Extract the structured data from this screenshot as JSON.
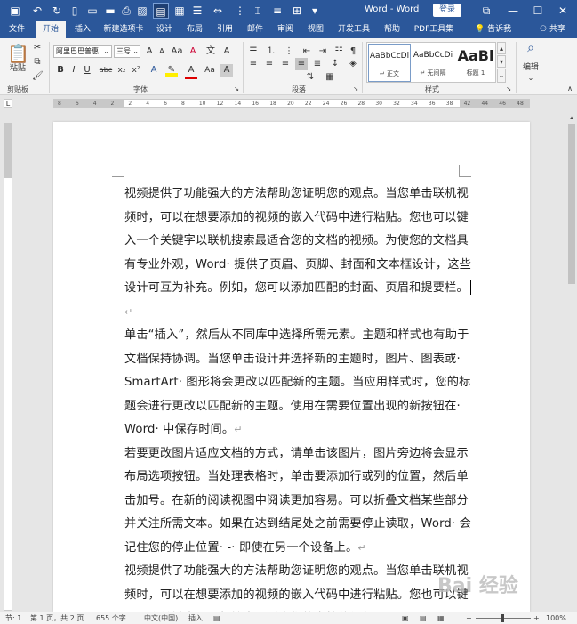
{
  "title_bar": {
    "quick_access": [
      "save-icon",
      "undo-icon",
      "redo-icon",
      "new-doc-icon",
      "print-preview-icon",
      "open-icon",
      "print-icon",
      "picture-icon",
      "read-mode-icon",
      "table-icon",
      "outline-icon",
      "spacing-icon",
      "more-icon",
      "page-icon",
      "customize-icon"
    ],
    "title": "Word - Word",
    "login": "登录",
    "window_controls": [
      "ribbon-display-icon",
      "minimize-icon",
      "restore-icon",
      "close-icon"
    ]
  },
  "tabs": [
    "文件",
    "开始",
    "插入",
    "新建选项卡",
    "设计",
    "布局",
    "引用",
    "邮件",
    "审阅",
    "视图",
    "开发工具",
    "帮助",
    "PDF工具集"
  ],
  "active_tab": "开始",
  "tell_me": "告诉我",
  "share": "共享",
  "ribbon": {
    "clipboard": {
      "paste": "粘贴",
      "label": "剪贴板"
    },
    "font": {
      "name": "阿里巴巴普惠",
      "size": "三号",
      "label": "字体",
      "buttons": [
        "B",
        "I",
        "U",
        "abc",
        "x₂",
        "x²",
        "A",
        "A",
        "Aa",
        "A"
      ]
    },
    "paragraph": {
      "label": "段落"
    },
    "styles": {
      "label": "样式",
      "items": [
        {
          "sample": "AaBbCcDi",
          "name": "↵ 正文"
        },
        {
          "sample": "AaBbCcDi",
          "name": "↵ 无间隔"
        },
        {
          "sample": "AaBl",
          "name": "标题 1"
        }
      ]
    },
    "editing": {
      "label": "编辑"
    }
  },
  "ruler_ticks": [
    "8",
    "6",
    "4",
    "2",
    "2",
    "4",
    "6",
    "8",
    "10",
    "12",
    "14",
    "16",
    "18",
    "20",
    "22",
    "24",
    "26",
    "28",
    "30",
    "32",
    "34",
    "36",
    "38",
    "42",
    "44",
    "46",
    "48"
  ],
  "document": {
    "paragraphs": [
      "视频提供了功能强大的方法帮助您证明您的观点。当您单击联机视频时，可以在想要添加的视频的嵌入代码中进行粘贴。您也可以键入一个关键字以联机搜索最适合您的文档的视频。为使您的文档具有专业外观，Word· 提供了页眉、页脚、封面和文本框设计，这些设计可互为补充。例如，您可以添加匹配的封面、页眉和提要栏。",
      "单击“插入”，然后从不同库中选择所需元素。主题和样式也有助于文档保持协调。当您单击设计并选择新的主题时，图片、图表或· SmartArt· 图形将会更改以匹配新的主题。当应用样式时，您的标题会进行更改以匹配新的主题。使用在需要位置出现的新按钮在· Word· 中保存时间。",
      "若要更改图片适应文档的方式，请单击该图片，图片旁边将会显示布局选项按钮。当处理表格时，单击要添加行或列的位置，然后单击加号。在新的阅读视图中阅读更加容易。可以折叠文档某些部分并关注所需文本。如果在达到结尾处之前需要停止读取，Word· 会记住您的停止位置· -· 即使在另一个设备上。",
      "视频提供了功能强大的方法帮助您证明您的观点。当您单击联机视频时，可以在想要添加的视频的嵌入代码中进行粘贴。您也可以键入一个关键字以联机搜索最适合您的文档的视频。"
    ],
    "para_mark": "↵"
  },
  "status_bar": {
    "section": "节: 1",
    "page": "第 1 页，共 2 页",
    "words": "655 个字",
    "language": "中文(中国)",
    "mode": "插入",
    "zoom": "100%"
  },
  "watermark": "Bai 经验"
}
